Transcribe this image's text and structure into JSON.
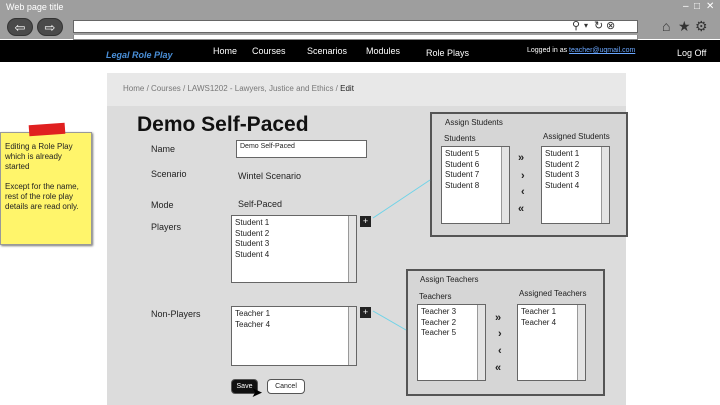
{
  "browser": {
    "title": "Web page title",
    "back_icon": "back-arrow-icon",
    "forward_icon": "forward-arrow-icon"
  },
  "nav": {
    "brand": "Legal Role Play",
    "items": [
      "Home",
      "Courses",
      "Scenarios",
      "Modules",
      "Role Plays"
    ],
    "logged_prefix": "Logged in as ",
    "logged_email": "teacher@uqmail.com",
    "logout": "Log Off"
  },
  "breadcrumb": {
    "path": "Home / Courses / LAWS1202 - Lawyers, Justice and Ethics / ",
    "current": "Edit"
  },
  "page": {
    "title": "Demo Self-Paced",
    "name_label": "Name",
    "name_value": "Demo Self-Paced",
    "scenario_label": "Scenario",
    "scenario_value": "Wintel Scenario",
    "mode_label": "Mode",
    "mode_value": "Self-Paced",
    "players_label": "Players",
    "players": [
      "Student 1",
      "Student 2",
      "Student 3",
      "Student 4"
    ],
    "nonplayers_label": "Non-Players",
    "nonplayers": [
      "Teacher 1",
      "Teacher 4"
    ],
    "save": "Save",
    "cancel": "Cancel"
  },
  "assign_students": {
    "title": "Assign Students",
    "left_label": "Students",
    "right_label": "Assigned Students",
    "available": [
      "Student 5",
      "Student 6",
      "Student 7",
      "Student 8"
    ],
    "assigned": [
      "Student 1",
      "Student 2",
      "Student 3",
      "Student 4"
    ],
    "arrows": [
      "»",
      "›",
      "‹",
      "«"
    ]
  },
  "assign_teachers": {
    "title": "Assign Teachers",
    "left_label": "Teachers",
    "right_label": "Assigned Teachers",
    "available": [
      "Teacher 3",
      "Teacher 2",
      "Teacher 5"
    ],
    "assigned": [
      "Teacher 1",
      "Teacher 4"
    ],
    "arrows": [
      "»",
      "›",
      "‹",
      "«"
    ]
  },
  "sticky_note": {
    "line1": "Editing a Role Play which is already started",
    "line2": "Except for the name, rest of the role play details are read only."
  }
}
